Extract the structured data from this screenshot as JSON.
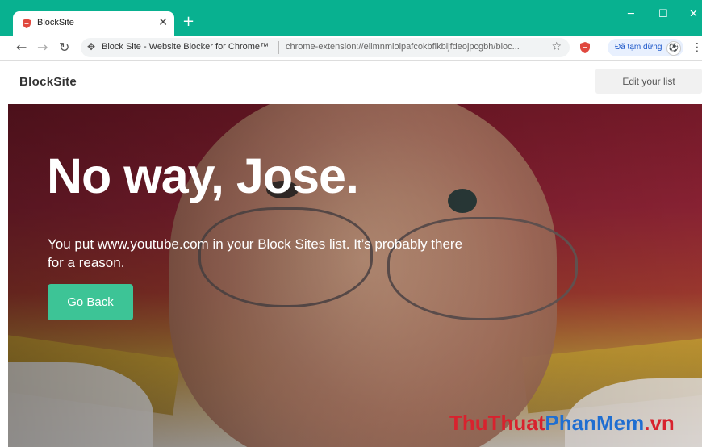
{
  "browser": {
    "tab_title": "BlockSite",
    "tab_close": "✕",
    "new_tab": "+",
    "window_controls": {
      "minimize": "─",
      "maximize": "☐",
      "close": "✕"
    },
    "omnibox": {
      "page_title": "Block Site - Website Blocker for Chrome™",
      "url": "chrome-extension://eiimnmioipafcokbfikbljfdeojpcgbh/bloc..."
    },
    "paused_label": "Đã tạm dừng",
    "icons": [
      "back-arrow-icon",
      "forward-arrow-icon",
      "reload-icon",
      "extension-puzzle-icon",
      "star-icon",
      "shield-icon",
      "menu-dots-icon"
    ]
  },
  "page": {
    "logo": "BlockSite",
    "edit_button": "Edit your list",
    "headline": "No way, Jose.",
    "message": "You put www.youtube.com in your Block Sites list. It’s probably there for a reason.",
    "go_back_button": "Go Back"
  },
  "watermark": {
    "part1": "ThuThuat",
    "part2": "PhanMem",
    "part3": ".vn"
  },
  "colors": {
    "chrome_green": "#08b190",
    "button_green": "#3dc496",
    "watermark_red": "#d8222e",
    "watermark_blue": "#1f6ed1"
  }
}
